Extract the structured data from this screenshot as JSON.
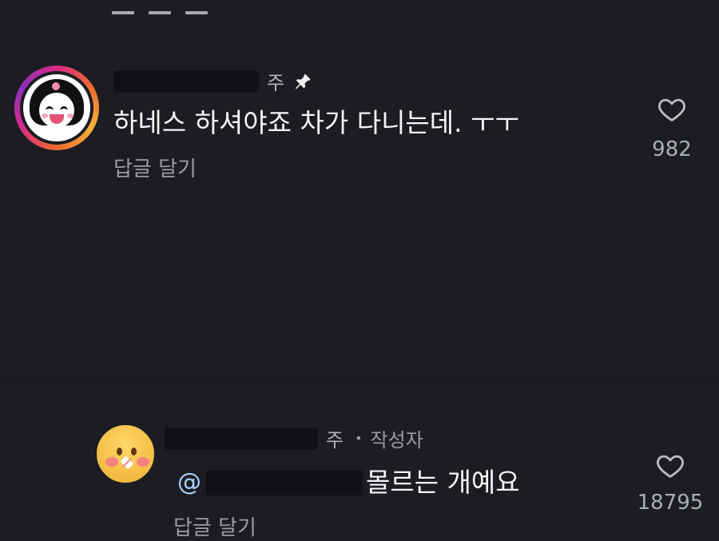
{
  "comments": [
    {
      "username_visible_fragment": "주",
      "pinned": true,
      "pin_icon": "pin-icon",
      "text": "하네스 하셔야죠 차가 다니는데. ㅜㅜ",
      "reply_label": "답글 달기",
      "like_icon": "heart-outline-icon",
      "like_count": "982",
      "avatar_icon": "kuromi-avatar-icon",
      "story_ring_colors": [
        "#f5b23a",
        "#ef6b2d",
        "#d62b83",
        "#8e2fbd"
      ]
    },
    {
      "username_visible_fragment": "주",
      "author_label": "작성자",
      "mention_prefix": "@",
      "text": "몰르는 개예요",
      "reply_label": "답글 달기",
      "like_icon": "heart-outline-icon",
      "like_count": "18795",
      "avatar_icon": "blushing-emoji-avatar-icon"
    }
  ],
  "colors": {
    "background": "#1c1d22",
    "primary_text": "#f5f5f5",
    "secondary_text": "#9a9ca3",
    "redaction": "#101114"
  }
}
